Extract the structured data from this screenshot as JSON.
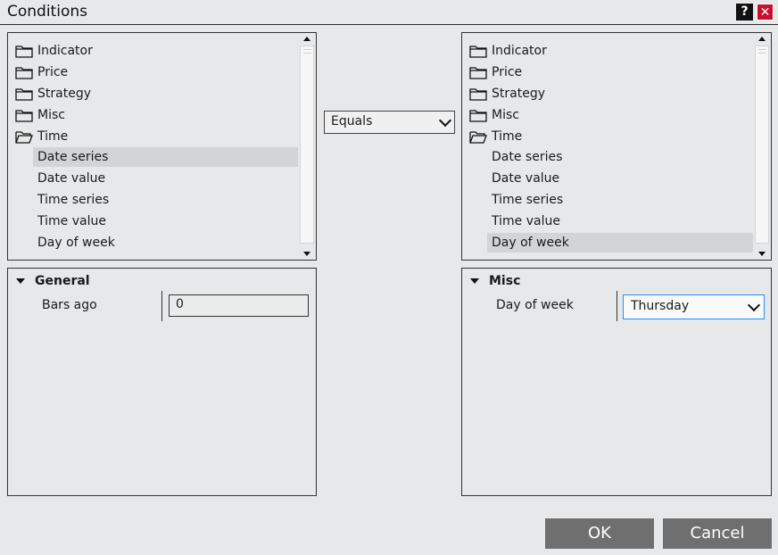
{
  "window": {
    "title": "Conditions",
    "help_label": "?",
    "close_label": "✕"
  },
  "left_tree": {
    "folders": [
      "Indicator",
      "Price",
      "Strategy",
      "Misc",
      "Time"
    ],
    "children": [
      "Date series",
      "Date value",
      "Time series",
      "Time value",
      "Day of week"
    ],
    "selected": "Date series"
  },
  "right_tree": {
    "folders": [
      "Indicator",
      "Price",
      "Strategy",
      "Misc",
      "Time"
    ],
    "children": [
      "Date series",
      "Date value",
      "Time series",
      "Time value",
      "Day of week"
    ],
    "selected": "Day of week"
  },
  "operator": {
    "value": "Equals"
  },
  "left_props": {
    "section": "General",
    "label": "Bars ago",
    "value": "0"
  },
  "right_props": {
    "section": "Misc",
    "label": "Day of week",
    "value": "Thursday"
  },
  "buttons": {
    "ok": "OK",
    "cancel": "Cancel"
  },
  "icons": {
    "closed": "folder-icon",
    "open": "folder-open-icon"
  }
}
